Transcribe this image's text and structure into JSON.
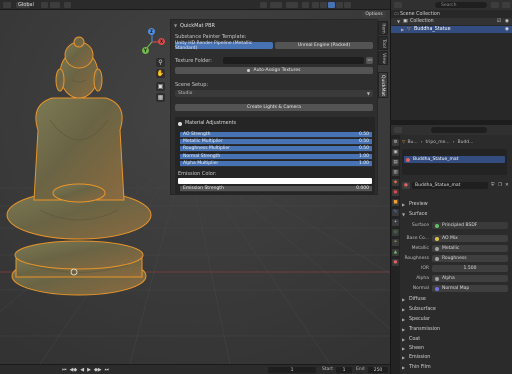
{
  "header": {
    "orientation_label": "Global",
    "options_label": "Options"
  },
  "viewport_nav": {
    "icons": [
      "zoom-icon",
      "hand-icon",
      "camera-icon",
      "grid-icon"
    ],
    "gizmo": {
      "x": "X",
      "y": "Y",
      "z": "Z"
    }
  },
  "panel": {
    "title": "QuickMat PBR",
    "template_label": "Substance Painter Template:",
    "template_options": [
      "Unity HD Render Pipeline (Metallic Standard)",
      "Unreal Engine (Packed)"
    ],
    "texture_folder_label": "Texture Folder:",
    "texture_folder_value": "",
    "auto_assign_label": "Auto-Assign Textures",
    "scene_setup_label": "Scene Setup:",
    "scene_setup_value": "Studio",
    "create_lights_label": "Create Lights & Camera",
    "adjustments_title": "Material Adjustments",
    "sliders": [
      {
        "label": "AO Strength",
        "value": "0.50"
      },
      {
        "label": "Metallic Multiplier",
        "value": "0.50"
      },
      {
        "label": "Roughness Multiplier",
        "value": "0.50"
      },
      {
        "label": "Normal Strength",
        "value": "1.00"
      },
      {
        "label": "Alpha Multiplier",
        "value": "1.00"
      }
    ],
    "emission_color_label": "Emission Color:",
    "emission_color": "#ffffff",
    "emission_strength_label": "Emission Strength",
    "emission_strength_value": "0.000"
  },
  "sidebar_tabs": [
    "Item",
    "Tool",
    "View",
    "QuickMat"
  ],
  "outliner": {
    "search_placeholder": "Search",
    "rows": [
      {
        "label": "Scene Collection"
      },
      {
        "label": "Collection"
      },
      {
        "label": "Buddha_Statue"
      }
    ]
  },
  "properties": {
    "breadcrumb": [
      "Bu...",
      "tripo_me...",
      "Budd..."
    ],
    "material_slot": "Buddha_Statue_mat",
    "material_name": "Buddha_Statue_mat",
    "sections": {
      "preview": "Preview",
      "surface": "Surface"
    },
    "surface_label": "Surface",
    "surface_value": "Principled BSDF",
    "fields": [
      {
        "label": "Base Co...",
        "value": "AO Mix",
        "color": "#e0c040"
      },
      {
        "label": "Metallic",
        "value": "Metallic",
        "color": "#a0a0a0"
      },
      {
        "label": "Roughness",
        "value": "Roughness",
        "color": "#a0a0a0"
      },
      {
        "label": "IOR",
        "value": "1.500",
        "color": ""
      },
      {
        "label": "Alpha",
        "value": "Alpha",
        "color": "#a0a0a0"
      },
      {
        "label": "Normal",
        "value": "Normal Map",
        "color": "#7070e0"
      }
    ],
    "subsections": [
      "Diffuse",
      "Subsurface",
      "Specular",
      "Transmission",
      "Coat",
      "Sheen",
      "Emission",
      "Thin Film"
    ]
  },
  "timeline": {
    "current_frame": "1",
    "start_label": "Start",
    "start_value": "1",
    "end_label": "End",
    "end_value": "250"
  },
  "colors": {
    "accent": "#4772b3",
    "viewport_bg": "#3a3a3a",
    "statue_patina": "#6e6a48",
    "selection_outline": "#e8952a"
  }
}
